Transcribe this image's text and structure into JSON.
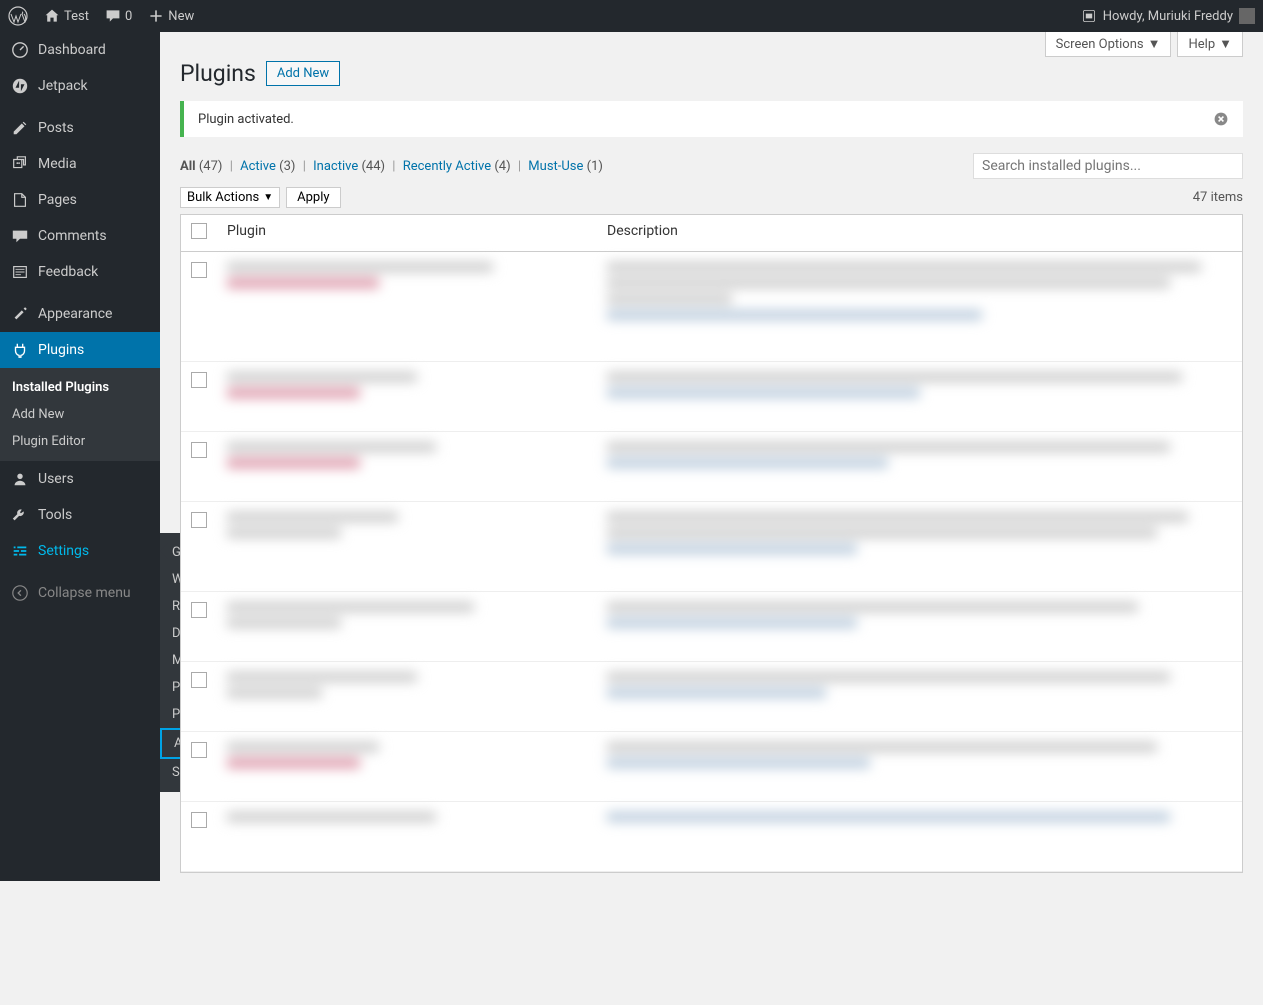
{
  "toolbar": {
    "site_name": "Test",
    "comments_count": "0",
    "new_label": "New",
    "howdy": "Howdy, Muriuki Freddy"
  },
  "sidebar": {
    "dashboard": "Dashboard",
    "jetpack": "Jetpack",
    "posts": "Posts",
    "media": "Media",
    "pages": "Pages",
    "comments": "Comments",
    "feedback": "Feedback",
    "appearance": "Appearance",
    "plugins": "Plugins",
    "users": "Users",
    "tools": "Tools",
    "settings": "Settings",
    "collapse": "Collapse menu"
  },
  "plugins_submenu": {
    "installed": "Installed Plugins",
    "add_new": "Add New",
    "editor": "Plugin Editor"
  },
  "settings_flyout": {
    "general": "General",
    "writing": "Writing",
    "reading": "Reading",
    "discussion": "Discussion",
    "media": "Media",
    "permalinks": "Permalinks",
    "privacy": "Privacy",
    "auto_post": "Auto Post Scheduler",
    "sharing": "Sharing"
  },
  "header": {
    "title": "Plugins",
    "add_new": "Add New",
    "screen_options": "Screen Options",
    "help": "Help"
  },
  "notice": {
    "text": "Plugin activated."
  },
  "filters": {
    "all_label": "All",
    "all_count": "(47)",
    "active_label": "Active",
    "active_count": "(3)",
    "inactive_label": "Inactive",
    "inactive_count": "(44)",
    "recently_label": "Recently Active",
    "recently_count": "(4)",
    "mustuse_label": "Must-Use",
    "mustuse_count": "(1)"
  },
  "search": {
    "placeholder": "Search installed plugins..."
  },
  "bulk": {
    "label": "Bulk Actions",
    "apply": "Apply"
  },
  "item_count": "47 items",
  "table": {
    "plugin": "Plugin",
    "description": "Description"
  }
}
